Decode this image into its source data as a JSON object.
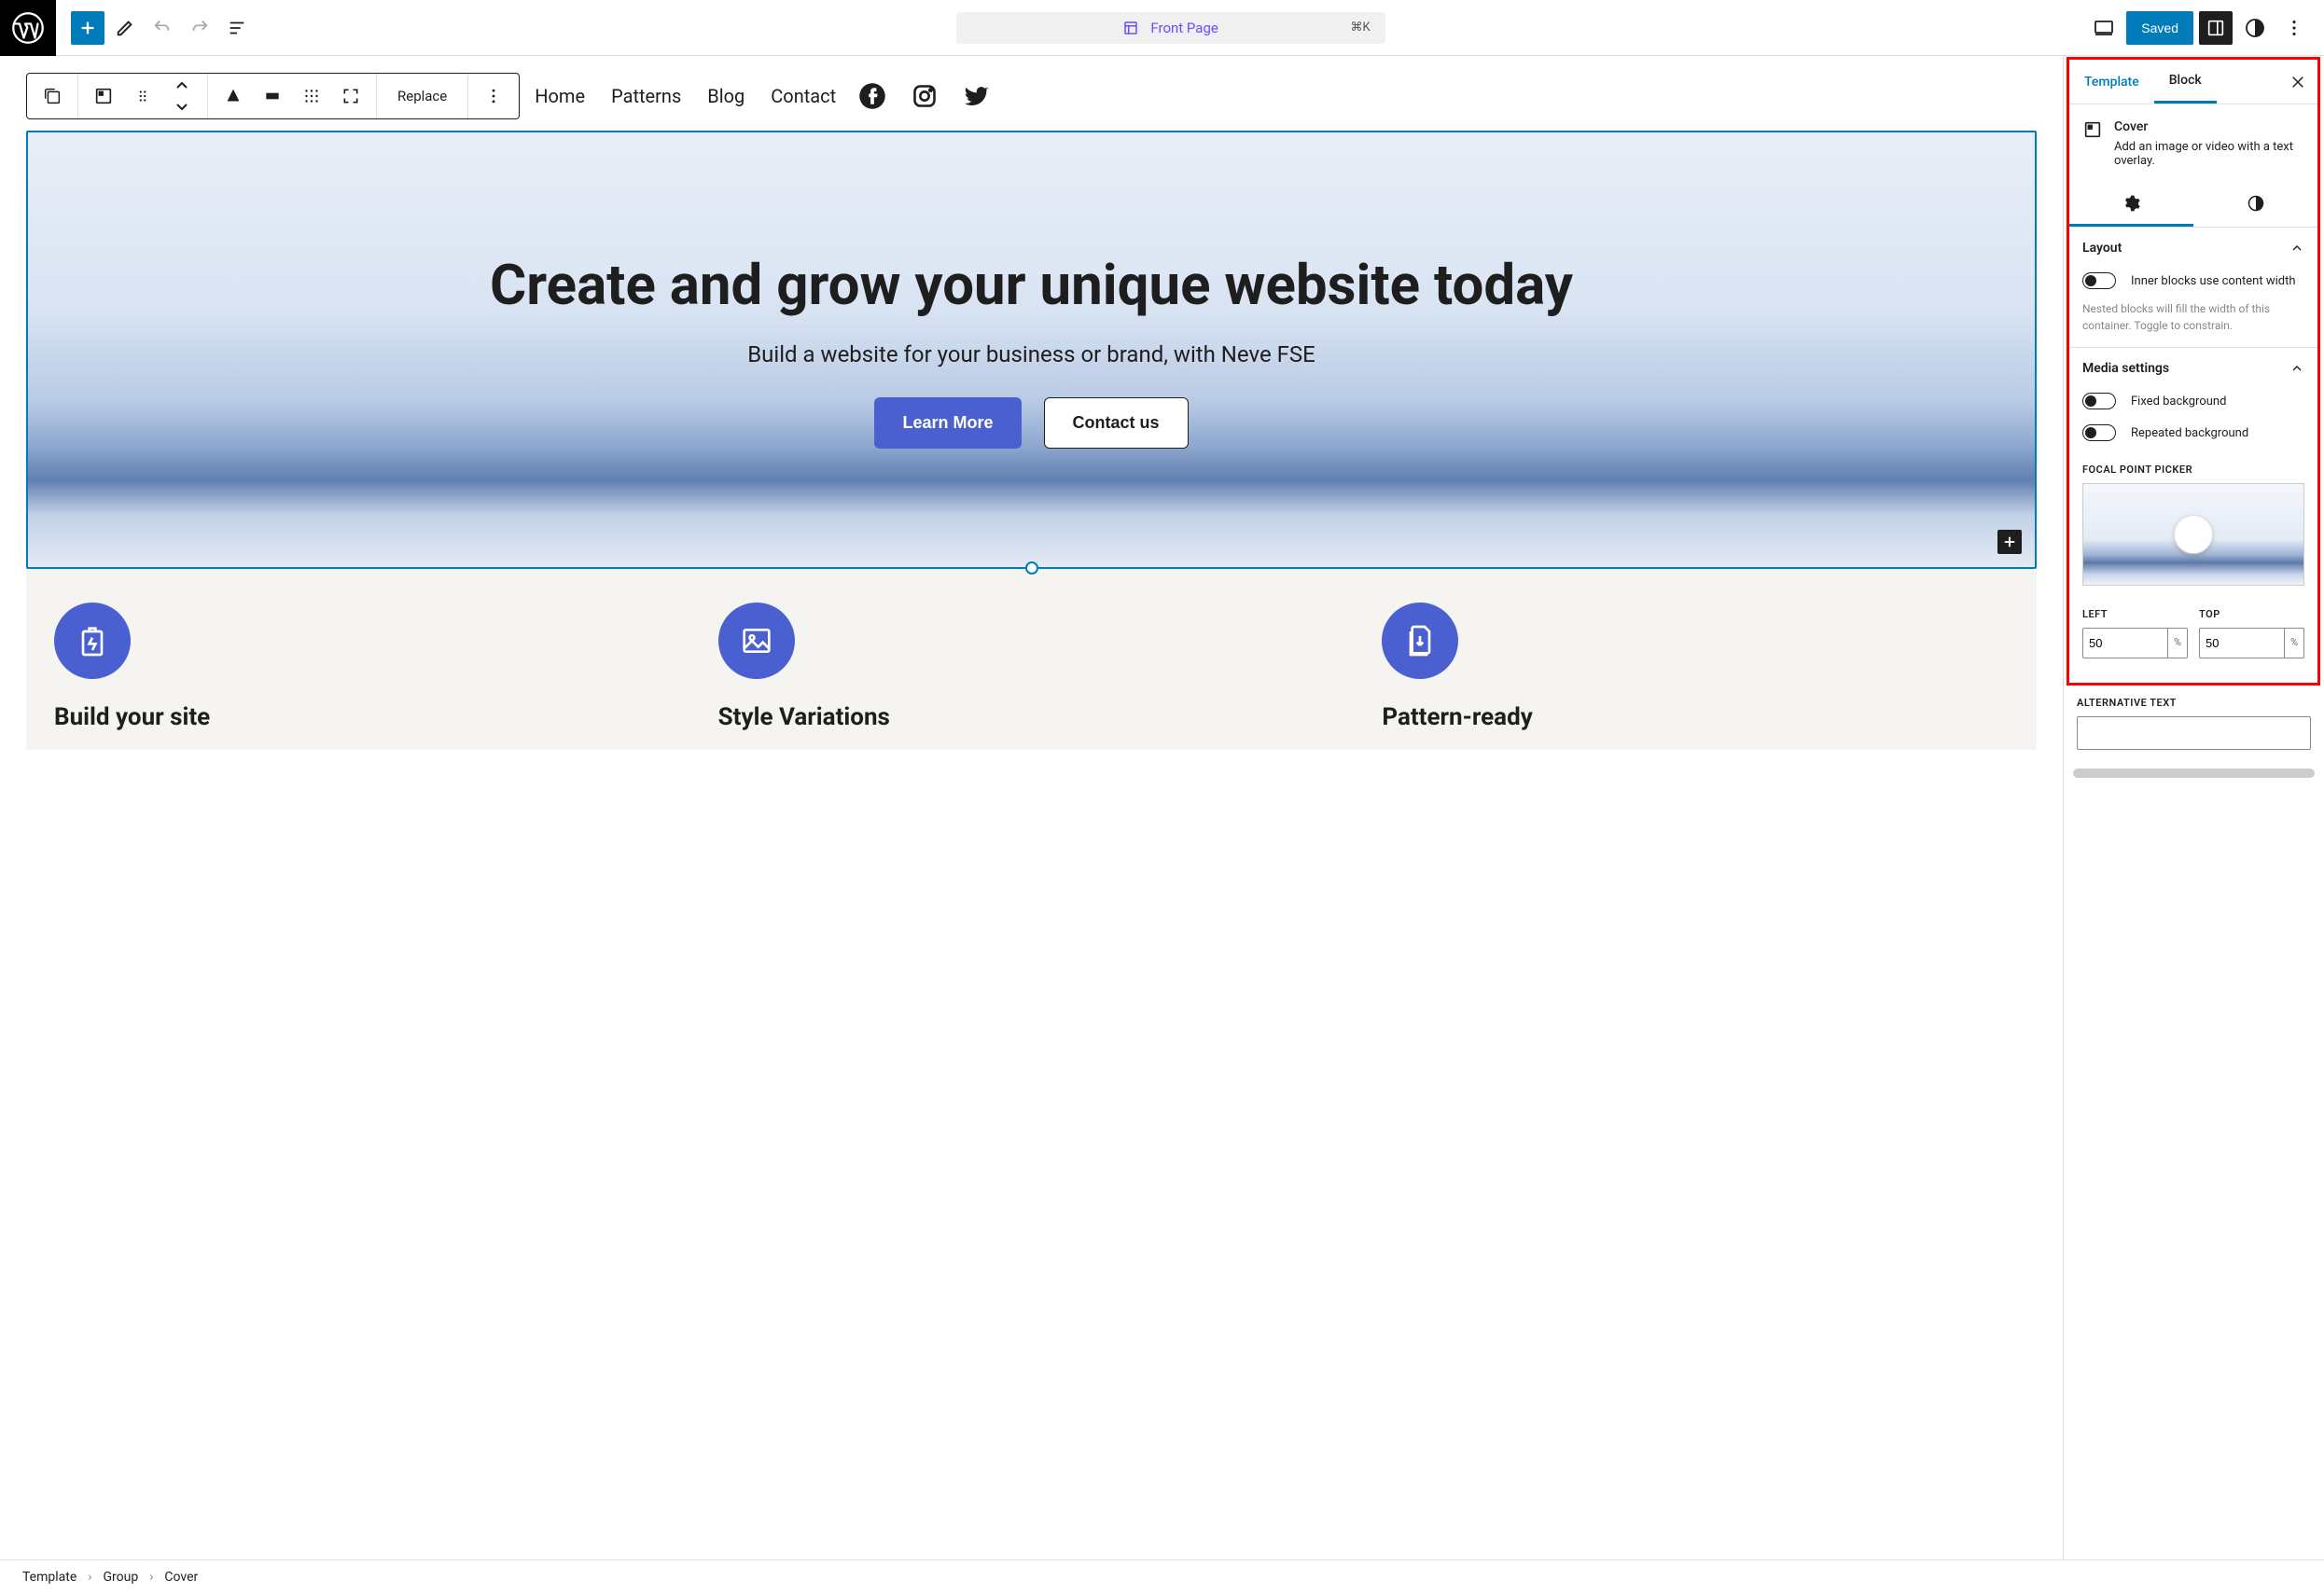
{
  "topbar": {
    "doc_title": "Front Page",
    "shortcut": "⌘K",
    "save_label": "Saved"
  },
  "block_toolbar": {
    "replace_label": "Replace"
  },
  "nav": {
    "items": [
      "Home",
      "Patterns",
      "Blog",
      "Contact"
    ]
  },
  "cover": {
    "heading": "Create and grow your unique website today",
    "subheading": "Build a website for your business or brand, with Neve FSE",
    "primary_button": "Learn More",
    "secondary_button": "Contact us"
  },
  "features": [
    {
      "icon": "battery",
      "title": "Build your site"
    },
    {
      "icon": "image",
      "title": "Style Variations"
    },
    {
      "icon": "download-doc",
      "title": "Pattern-ready"
    }
  ],
  "sidebar": {
    "tabs": {
      "template": "Template",
      "block": "Block"
    },
    "block_name": "Cover",
    "block_description": "Add an image or video with a text overlay.",
    "layout": {
      "title": "Layout",
      "inner_width_label": "Inner blocks use content width",
      "help": "Nested blocks will fill the width of this container. Toggle to constrain."
    },
    "media": {
      "title": "Media settings",
      "fixed_label": "Fixed background",
      "repeated_label": "Repeated background",
      "focal_title": "FOCAL POINT PICKER",
      "left_label": "LEFT",
      "top_label": "TOP",
      "left_value": "50",
      "top_value": "50",
      "unit": "%",
      "alt_label": "ALTERNATIVE TEXT"
    }
  },
  "breadcrumb": [
    "Template",
    "Group",
    "Cover"
  ]
}
